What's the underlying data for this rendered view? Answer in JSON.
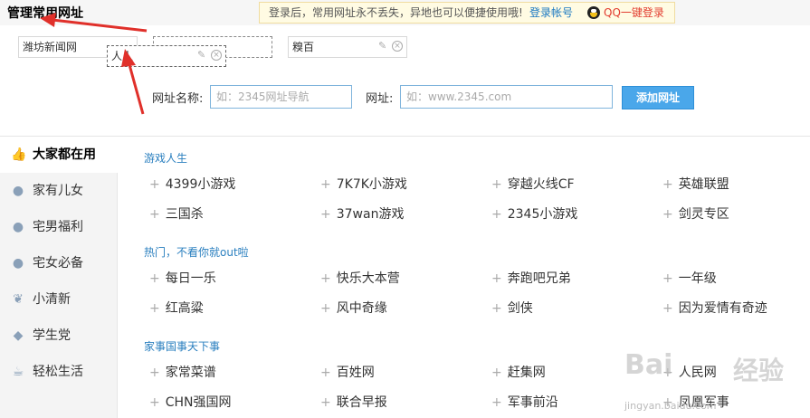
{
  "manage": {
    "title": "管理常用网址",
    "login_tip": "登录后，常用网址永不丢失，异地也可以便捷使用哦!",
    "login_link": "登录帐号",
    "qq_login": "QQ一键登录"
  },
  "chips": [
    {
      "label": "潍坊新闻网"
    },
    {
      "label": ""
    },
    {
      "label": "糗百"
    }
  ],
  "drag_chip": {
    "label": "人人"
  },
  "form": {
    "name_label": "网址名称:",
    "name_placeholder": "如：2345网址导航",
    "url_label": "网址:",
    "url_placeholder": "如：www.2345.com",
    "add_button": "添加网址"
  },
  "sidebar": {
    "items": [
      {
        "label": "大家都在用",
        "icon": "thumbs-up-icon",
        "active": true
      },
      {
        "label": "家有儿女",
        "icon": "family-icon"
      },
      {
        "label": "宅男福利",
        "icon": "man-icon"
      },
      {
        "label": "宅女必备",
        "icon": "woman-icon"
      },
      {
        "label": "小清新",
        "icon": "leaf-icon"
      },
      {
        "label": "学生党",
        "icon": "graduation-cap-icon"
      },
      {
        "label": "轻松生活",
        "icon": "cup-icon"
      }
    ]
  },
  "sections": [
    {
      "title": "游戏人生",
      "sites": [
        "4399小游戏",
        "7K7K小游戏",
        "穿越火线CF",
        "英雄联盟",
        "三国杀",
        "37wan游戏",
        "2345小游戏",
        "剑灵专区"
      ]
    },
    {
      "title": "热门，不看你就out啦",
      "sites": [
        "每日一乐",
        "快乐大本营",
        "奔跑吧兄弟",
        "一年级",
        "红高粱",
        "风中奇缘",
        "剑侠",
        "因为爱情有奇迹"
      ]
    },
    {
      "title": "家事国事天下事",
      "sites": [
        "家常菜谱",
        "百姓网",
        "赶集网",
        "人民网",
        "CHN强国网",
        "联合早报",
        "军事前沿",
        "凤凰军事"
      ]
    }
  ],
  "watermark": {
    "logo": "Bai",
    "cn": "经验",
    "url": "jingyan.baidu.com"
  }
}
